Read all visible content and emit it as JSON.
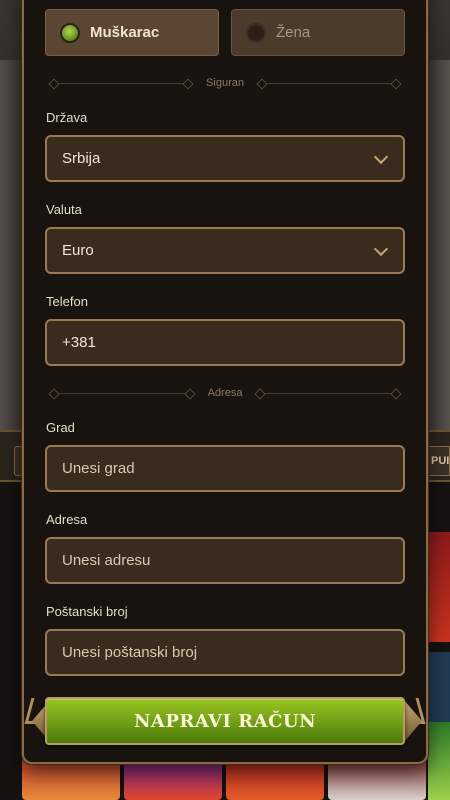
{
  "gender": {
    "male_label": "Muškarac",
    "female_label": "Žena",
    "selected": "male"
  },
  "sections": {
    "secure_label": "Siguran",
    "address_label": "Adresa"
  },
  "fields": {
    "country": {
      "label": "Država",
      "value": "Srbija"
    },
    "currency": {
      "label": "Valuta",
      "value": "Euro"
    },
    "phone": {
      "label": "Telefon",
      "value": "+381"
    },
    "city": {
      "label": "Grad",
      "placeholder": "Unesi grad"
    },
    "address": {
      "label": "Adresa",
      "placeholder": "Unesi adresu"
    },
    "postal": {
      "label": "Poštanski broj",
      "placeholder": "Unesi poštanski broj"
    }
  },
  "submit": {
    "label": "NAPRAVI RAČUN"
  },
  "background": {
    "bar_partial_text": "PUI"
  },
  "colors": {
    "accent_green": "#7fae1b",
    "border_gold": "#9a7a52",
    "field_bg": "#3a2b1f"
  }
}
